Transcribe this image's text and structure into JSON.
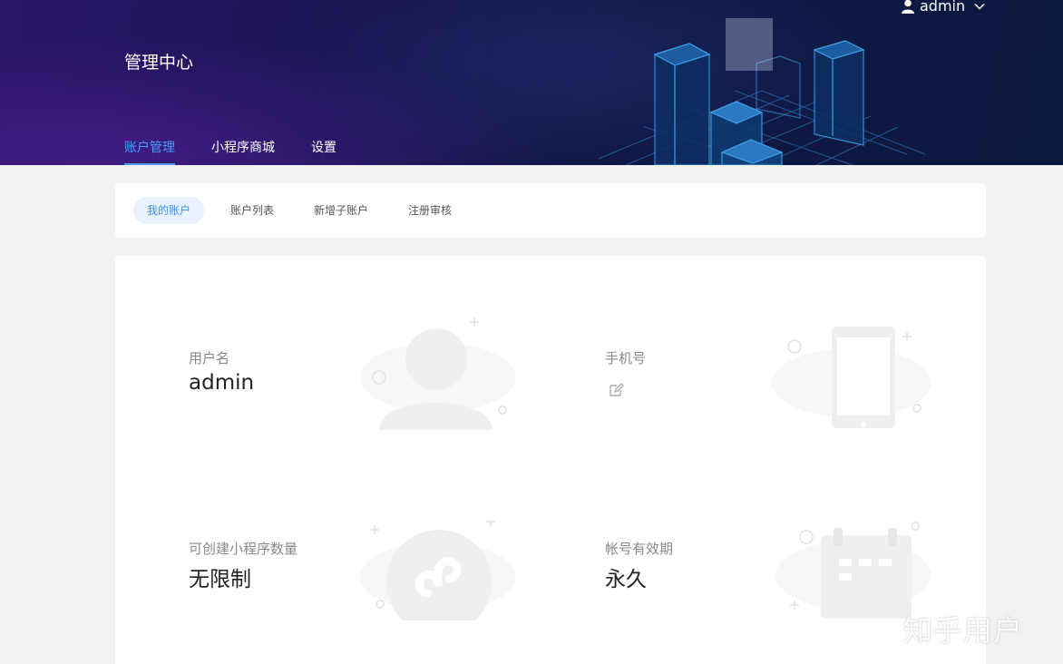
{
  "header": {
    "title": "管理中心",
    "user": {
      "name": "admin"
    },
    "nav": [
      {
        "label": "账户管理",
        "active": true
      },
      {
        "label": "小程序商城",
        "active": false
      },
      {
        "label": "设置",
        "active": false
      }
    ]
  },
  "subnav": {
    "tabs": [
      {
        "label": "我的账户",
        "active": true
      },
      {
        "label": "账户列表",
        "active": false
      },
      {
        "label": "新增子账户",
        "active": false
      },
      {
        "label": "注册审核",
        "active": false
      }
    ]
  },
  "account": {
    "username": {
      "label": "用户名",
      "value": "admin"
    },
    "phone": {
      "label": "手机号",
      "value": ""
    },
    "miniprogram_quota": {
      "label": "可创建小程序数量",
      "value": "无限制"
    },
    "validity": {
      "label": "帐号有效期",
      "value": "永久"
    }
  },
  "watermark": "知乎用户",
  "colors": {
    "accent": "#4a9cff",
    "tab_active_bg": "#e9f2fd",
    "tab_active_text": "#3a8ee6",
    "illustration": "#f0f0f2"
  },
  "icons": {
    "user_menu": "user-icon",
    "user_menu_caret": "chevron-down-icon",
    "phone_edit": "edit-icon",
    "username_illustration": "person-icon",
    "phone_illustration": "mobile-phone-icon",
    "miniprogram_illustration": "miniprogram-icon",
    "validity_illustration": "calendar-icon"
  }
}
